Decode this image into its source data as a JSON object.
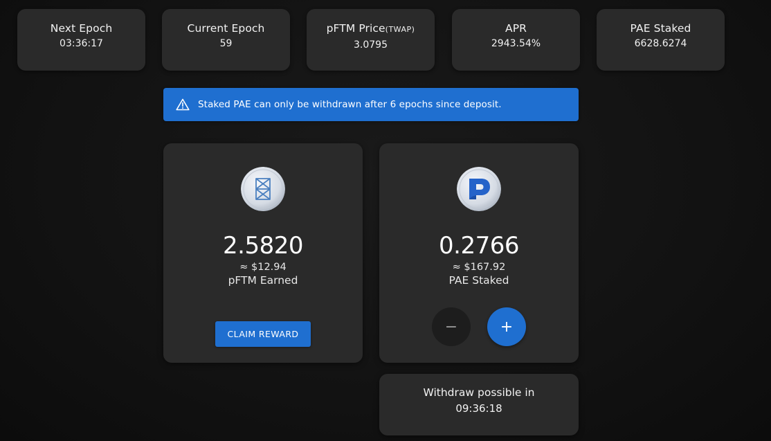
{
  "stats": [
    {
      "label": "Next Epoch",
      "value": "03:36:17"
    },
    {
      "label": "Current Epoch",
      "value": "59"
    },
    {
      "label": "pFTM Price",
      "label_suffix": "(TWAP)",
      "value": "3.0795"
    },
    {
      "label": "APR",
      "value": "2943.54%"
    },
    {
      "label": "PAE Staked",
      "value": "6628.6274"
    }
  ],
  "alert": {
    "icon": "warning-triangle-icon",
    "text": "Staked PAE can only be withdrawn after 6 epochs since deposit."
  },
  "earned_card": {
    "logo_icon": "fantom-logo-icon",
    "amount": "2.5820",
    "usd": "≈ $12.94",
    "label": "pFTM Earned",
    "claim_label": "CLAIM REWARD"
  },
  "staked_card": {
    "logo_icon": "pae-logo-icon",
    "amount": "0.2766",
    "usd": "≈ $167.92",
    "label": "PAE Staked",
    "minus_label": "−",
    "plus_label": "+"
  },
  "withdraw": {
    "label": "Withdraw possible in",
    "value": "09:36:18"
  },
  "colors": {
    "accent": "#1f6fd0",
    "card": "#2a2a2a",
    "background": "#121212"
  }
}
